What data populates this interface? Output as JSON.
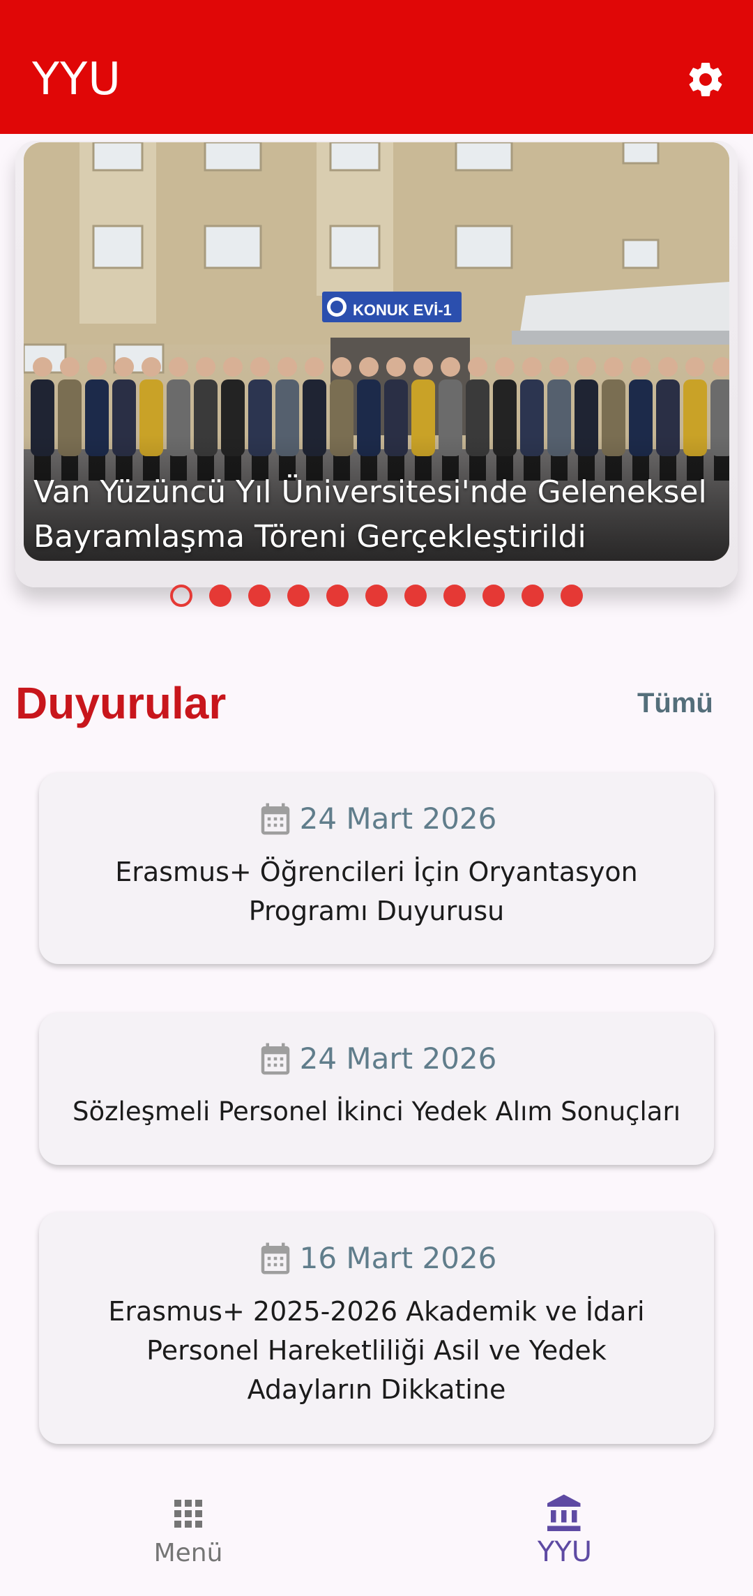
{
  "appbar": {
    "title": "YYU",
    "color": "#e00707",
    "settings_icon": "gear-icon"
  },
  "carousel": {
    "caption": "Van Yüzüncü Yıl Üniversitesi'nde Geleneksel Bayramlaşma Töreni Gerçekleştirildi",
    "building_sign": "KONUK EVİ-1",
    "total_slides": 11,
    "active_index": 0,
    "dot_color": "#e53935"
  },
  "announcements": {
    "title": "Duyurular",
    "see_all_label": "Tümü",
    "items": [
      {
        "date": "24 Mart 2026",
        "title": "Erasmus+ Öğrencileri İçin Oryantasyon Programı Duyurusu",
        "date_icon": "calendar-icon"
      },
      {
        "date": "24 Mart 2026",
        "title": "Sözleşmeli Personel İkinci Yedek Alım Sonuçları",
        "date_icon": "calendar-icon"
      },
      {
        "date": "16 Mart 2026",
        "title": "Erasmus+ 2025-2026 Akademik ve İdari Personel Hareketliliği Asil ve Yedek Adayların Dikkatine",
        "date_icon": "calendar-icon"
      }
    ]
  },
  "bottom_nav": {
    "items": [
      {
        "label": "Menü",
        "icon": "grid-icon",
        "selected": false
      },
      {
        "label": "YYU",
        "icon": "university-icon",
        "selected": true
      }
    ],
    "selected_color": "#5e4aa3"
  }
}
